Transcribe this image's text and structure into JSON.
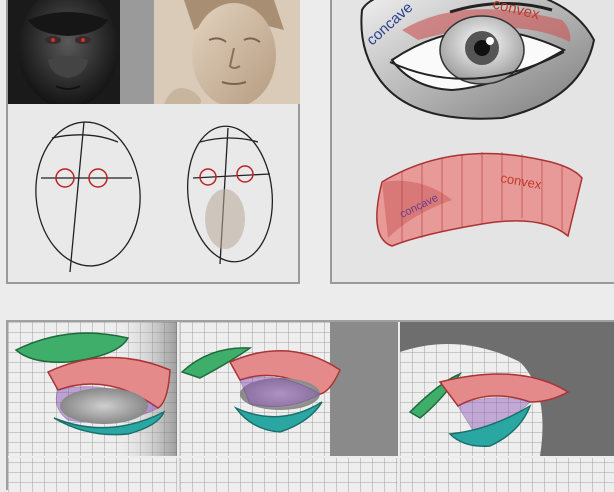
{
  "labels": {
    "concave_eye": "concave",
    "convex_eye": "convex",
    "concave_ribbon": "concave",
    "convex_ribbon": "convex"
  },
  "colors": {
    "concave_text": "#2b3f8f",
    "convex_text": "#c0392b",
    "lid_red": "#e58a8a",
    "lid_green": "#3fae6b",
    "lid_teal": "#2aa7a2",
    "lid_purple": "#8e56b8"
  }
}
